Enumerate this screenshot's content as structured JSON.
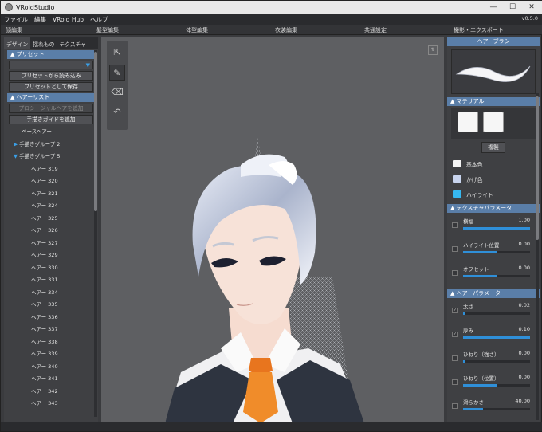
{
  "window": {
    "title": "VRoidStudio",
    "version": "v0.5.0"
  },
  "menu": [
    "ファイル",
    "編集",
    "VRoid Hub",
    "ヘルプ"
  ],
  "top_tabs": [
    "顔編集",
    "髪型編集",
    "体型編集",
    "衣装編集",
    "共通設定",
    "撮影・エクスポート"
  ],
  "left": {
    "subtabs": [
      "デザイン",
      "揺れもの",
      "テクスチャ"
    ],
    "preset_header": "プリセット",
    "load_preset": "プリセットから読み込み",
    "save_preset": "プリセットとして保存",
    "hairlist_header": "ヘアーリスト",
    "add_procedural": "プロシージャルヘアを追加",
    "add_guide": "手描きガイドを追加",
    "base_hair": "ベースヘアー",
    "groups": [
      "手描きグループ 2",
      "手描きグループ 5"
    ],
    "items": [
      "ヘアー 319",
      "ヘアー 320",
      "ヘアー 321",
      "ヘアー 324",
      "ヘアー 325",
      "ヘアー 326",
      "ヘアー 327",
      "ヘアー 329",
      "ヘアー 330",
      "ヘアー 331",
      "ヘアー 334",
      "ヘアー 335",
      "ヘアー 336",
      "ヘアー 337",
      "ヘアー 338",
      "ヘアー 339",
      "ヘアー 340",
      "ヘアー 341",
      "ヘアー 342",
      "ヘアー 343"
    ]
  },
  "tools": [
    "cursor-icon",
    "pen-icon",
    "eraser-icon",
    "undo-icon"
  ],
  "right": {
    "header": "ヘアーブラシ",
    "material_header": "マテリアル",
    "duplicate": "複製",
    "colors": [
      {
        "label": "基本色",
        "color": "#f4f4f4"
      },
      {
        "label": "かげ色",
        "color": "#c8d4ee"
      },
      {
        "label": "ハイライト",
        "color": "#36b8f0"
      }
    ],
    "texture_header": "テクスチャパラメータ",
    "texture_params": [
      {
        "label": "横幅",
        "value": "1.00",
        "fill": 1.0
      },
      {
        "label": "ハイライト位置",
        "value": "0.00",
        "fill": 0.5
      },
      {
        "label": "オフセット",
        "value": "0.00",
        "fill": 0.5
      }
    ],
    "hair_header": "ヘアーパラメータ",
    "hair_params": [
      {
        "label": "太さ",
        "value": "0.02",
        "fill": 0.02,
        "checked": true
      },
      {
        "label": "厚み",
        "value": "0.10",
        "fill": 1.0,
        "checked": true
      },
      {
        "label": "ひねり（強さ）",
        "value": "0.00",
        "fill": 0.0,
        "checked": false
      },
      {
        "label": "ひねり（位置）",
        "value": "0.00",
        "fill": 0.5,
        "checked": false
      },
      {
        "label": "滑らかさ",
        "value": "40.00",
        "fill": 0.3,
        "checked": false
      }
    ]
  }
}
